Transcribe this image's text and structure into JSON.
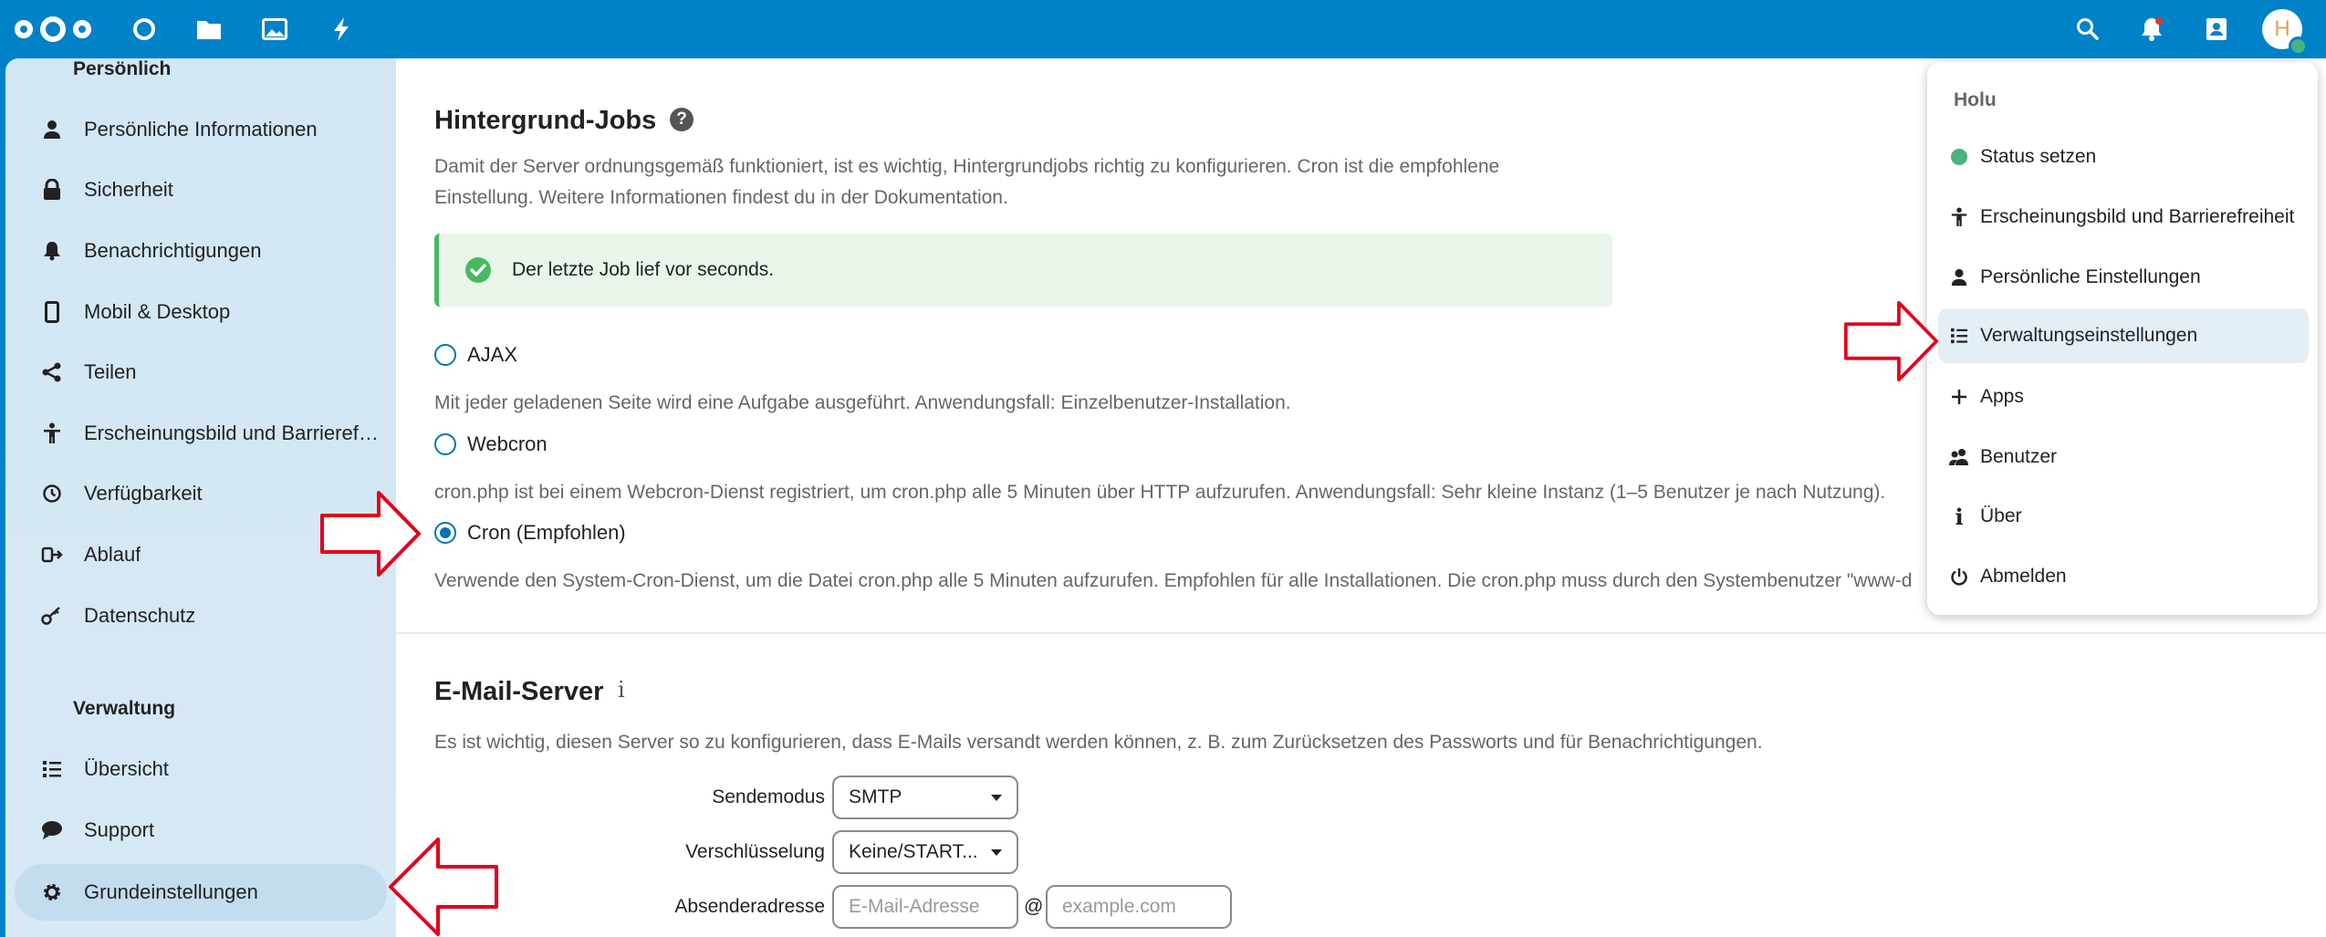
{
  "header": {
    "icons": [
      "nextcloud-logo",
      "dashboard-icon",
      "files-icon",
      "photos-icon",
      "activity-icon",
      "search-icon",
      "notifications-icon",
      "contacts-icon"
    ],
    "avatar_letter": "H"
  },
  "sidebar": {
    "personal_title": "Persönlich",
    "personal_items": [
      {
        "label": "Persönliche Informationen",
        "icon": "person-icon"
      },
      {
        "label": "Sicherheit",
        "icon": "lock-icon"
      },
      {
        "label": "Benachrichtigungen",
        "icon": "bell-icon"
      },
      {
        "label": "Mobil & Desktop",
        "icon": "phone-icon"
      },
      {
        "label": "Teilen",
        "icon": "share-icon"
      },
      {
        "label": "Erscheinungsbild und Barrierefreiheit",
        "icon": "accessibility-icon"
      },
      {
        "label": "Verfügbarkeit",
        "icon": "clock-icon"
      },
      {
        "label": "Ablauf",
        "icon": "flow-icon"
      },
      {
        "label": "Datenschutz",
        "icon": "key-icon"
      }
    ],
    "admin_title": "Verwaltung",
    "admin_items": [
      {
        "label": "Übersicht",
        "icon": "list-icon"
      },
      {
        "label": "Support",
        "icon": "chat-icon"
      },
      {
        "label": "Grundeinstellungen",
        "icon": "gear-icon"
      }
    ]
  },
  "background_jobs": {
    "title": "Hintergrund-Jobs",
    "description_line1": "Damit der Server ordnungsgemäß funktioniert, ist es wichtig, Hintergrundjobs richtig zu konfigurieren. Cron ist die empfohlene",
    "description_line2": "Einstellung. Weitere Informationen findest du in der Dokumentation.",
    "notice": "Der letzte Job lief vor seconds.",
    "options": [
      {
        "label": "AJAX",
        "checked": false,
        "description": "Mit jeder geladenen Seite wird eine Aufgabe ausgeführt. Anwendungsfall: Einzelbenutzer-Installation."
      },
      {
        "label": "Webcron",
        "checked": false,
        "description": "cron.php ist bei einem Webcron-Dienst registriert, um cron.php alle 5 Minuten über HTTP aufzurufen. Anwendungsfall: Sehr kleine Instanz (1–5 Benutzer je nach Nutzung)."
      },
      {
        "label": "Cron (Empfohlen)",
        "checked": true,
        "description": "Verwende den System-Cron-Dienst, um die Datei cron.php alle 5 Minuten aufzurufen. Empfohlen für alle Installationen. Die cron.php muss durch den Systembenutzer \"www-d"
      }
    ]
  },
  "email_server": {
    "title": "E-Mail-Server",
    "description": "Es ist wichtig, diesen Server so zu konfigurieren, dass E-Mails versandt werden können, z. B. zum Zurücksetzen des Passworts und für Benachrichtigungen.",
    "send_mode_label": "Sendemodus",
    "send_mode_value": "SMTP",
    "encryption_label": "Verschlüsselung",
    "encryption_value": "Keine/START...",
    "sender_label": "Absenderadresse",
    "sender_placeholder": "E-Mail-Adresse",
    "at": "@",
    "domain_placeholder": "example.com"
  },
  "user_menu": {
    "username": "Holu",
    "items": [
      {
        "label": "Status setzen",
        "icon": "status-dot"
      },
      {
        "label": "Erscheinungsbild und Barrierefreiheit",
        "icon": "accessibility-icon"
      },
      {
        "label": "Persönliche Einstellungen",
        "icon": "person-icon"
      },
      {
        "label": "Verwaltungseinstellungen",
        "icon": "list-icon"
      },
      {
        "label": "Apps",
        "icon": "plus-icon"
      },
      {
        "label": "Benutzer",
        "icon": "users-icon"
      },
      {
        "label": "Über",
        "icon": "info-icon"
      },
      {
        "label": "Abmelden",
        "icon": "power-icon"
      }
    ]
  },
  "colors": {
    "brand": "#0082c9",
    "sidebar": "#d5e8f5",
    "success": "#46ba61",
    "annotation_arrow": "#e2001a"
  }
}
